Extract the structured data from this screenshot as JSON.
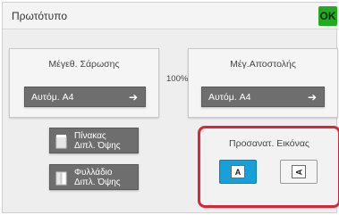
{
  "header": {
    "title": "Πρωτότυπο",
    "ok_label": "OK"
  },
  "scan_size": {
    "label": "Μέγεθ. Σάρωσης",
    "value": "Αυτόμ. A4"
  },
  "send_size": {
    "label": "Μέγ.Αποστολής",
    "value": "Αυτόμ. A4"
  },
  "ratio": "100%",
  "buttons": {
    "table_duplex": {
      "line1": "Πίνακας",
      "line2": "Διπλ. Όψης"
    },
    "booklet_duplex": {
      "line1": "Φυλλάδιο",
      "line2": "Διπλ. Όψης"
    }
  },
  "orientation": {
    "label": "Προσανατ. Εικόνας",
    "portrait_glyph": "A",
    "landscape_glyph": "A",
    "selected": "portrait"
  },
  "colors": {
    "accent": "#1aa0d8",
    "highlight": "#d9263a",
    "ok": "#22aa22"
  }
}
